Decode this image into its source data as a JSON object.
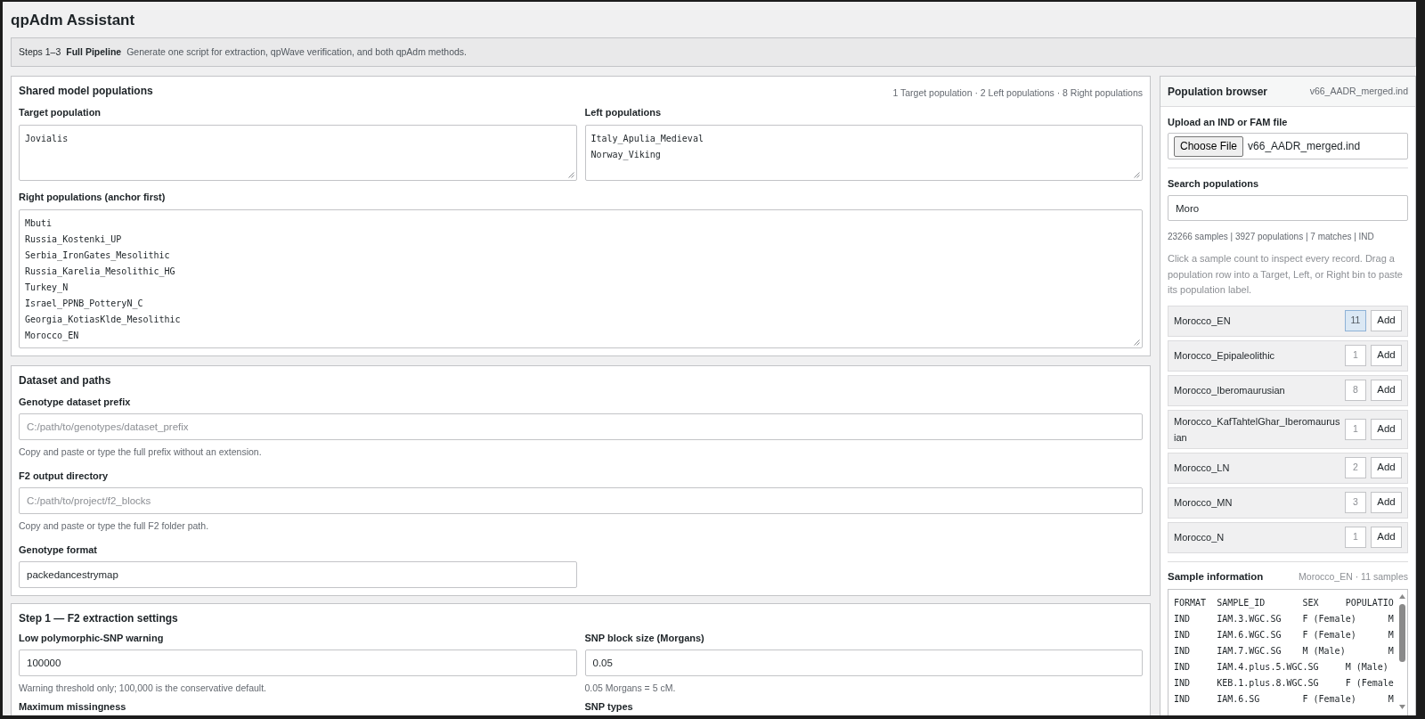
{
  "page": {
    "title": "qpAdm Assistant"
  },
  "steps_bar": {
    "steps": "Steps 1–3",
    "mode": "Full Pipeline",
    "description": "Generate one script for extraction, qpWave verification, and both qpAdm methods."
  },
  "shared_model_populations": {
    "title": "Shared model populations",
    "summary": "1 Target population · 2 Left populations · 8 Right populations",
    "fields": [
      {
        "label": "Target population",
        "entries": [
          "Jovialis"
        ]
      },
      {
        "label": "Left populations",
        "entries": [
          "Italy_Apulia_Medieval",
          "Norway_Viking"
        ]
      },
      {
        "label": "Right populations (anchor first)",
        "entries": [
          "Mbuti",
          "Russia_Kostenki_UP",
          "Serbia_IronGates_Mesolithic",
          "Russia_Karelia_Mesolithic_HG",
          "Turkey_N",
          "Israel_PPNB_PotteryN_C",
          "Georgia_KotiasKlde_Mesolithic",
          "Morocco_EN"
        ]
      }
    ]
  },
  "dataset_and_paths": {
    "title": "Dataset and paths",
    "fields": [
      {
        "label": "Genotype dataset prefix",
        "placeholder": "C:/path/to/genotypes/dataset_prefix",
        "hint": "Copy and paste or type the full prefix without an extension."
      },
      {
        "label": "F2 output directory",
        "placeholder": "C:/path/to/project/f2_blocks",
        "hint": "Copy and paste or type the full F2 folder path."
      },
      {
        "label": "Genotype format",
        "value": "packedancestrymap"
      }
    ]
  },
  "f2_extraction_settings": {
    "title": "Step 1 — F2 extraction settings",
    "fields": [
      {
        "label": "Low polymorphic-SNP warning",
        "value": "100000",
        "hint": "Warning threshold only; 100,000 is the conservative default."
      },
      {
        "label": "SNP block size (Morgans)",
        "value": "0.05",
        "hint": "0.05 Morgans = 5 cM."
      },
      {
        "label": "Maximum missingness"
      },
      {
        "label": "SNP types"
      }
    ]
  },
  "population_browser": {
    "title": "Population browser",
    "source": "v66_AADR_merged.ind",
    "upload_label": "Upload an IND or FAM file",
    "upload_button": "Choose File",
    "upload_file": "v66_AADR_merged.ind",
    "search_label": "Search populations",
    "search_value": "Moro",
    "stats": "23266 samples | 3927 populations | 7 matches | IND",
    "help": "Click a sample count to inspect every record. Drag a population row into a Target, Left, or Right bin to paste its population label.",
    "populations": [
      {
        "name": "Morocco_EN",
        "count": "11",
        "selected": true,
        "action": "Add"
      },
      {
        "name": "Morocco_Epipaleolithic",
        "count": "1",
        "selected": false,
        "action": "Add"
      },
      {
        "name": "Morocco_Iberomaurusian",
        "count": "8",
        "selected": false,
        "action": "Add"
      },
      {
        "name": "Morocco_KafTahtelGhar_Iberomaurusian",
        "count": "1",
        "selected": false,
        "action": "Add"
      },
      {
        "name": "Morocco_LN",
        "count": "2",
        "selected": false,
        "action": "Add"
      },
      {
        "name": "Morocco_MN",
        "count": "3",
        "selected": false,
        "action": "Add"
      },
      {
        "name": "Morocco_N",
        "count": "1",
        "selected": false,
        "action": "Add"
      }
    ]
  },
  "sample_information": {
    "title": "Sample information",
    "subtitle": "Morocco_EN · 11 samples",
    "columns": [
      "FORMAT",
      "SAMPLE_ID",
      "SEX",
      "POPULATIO"
    ],
    "rows": [
      [
        "IND",
        "IAM.3.WGC.SG",
        "F (Female)",
        "M"
      ],
      [
        "IND",
        "IAM.6.WGC.SG",
        "F (Female)",
        "M"
      ],
      [
        "IND",
        "IAM.7.WGC.SG",
        "M (Male)",
        "M"
      ],
      [
        "IND",
        "IAM.4.plus.5.WGC.SG",
        "M (Male)"
      ],
      [
        "IND",
        "KEB.1.plus.8.WGC.SG",
        "F (Female"
      ],
      [
        "IND",
        "IAM.6.SG",
        "F (Female)",
        "M"
      ]
    ]
  }
}
